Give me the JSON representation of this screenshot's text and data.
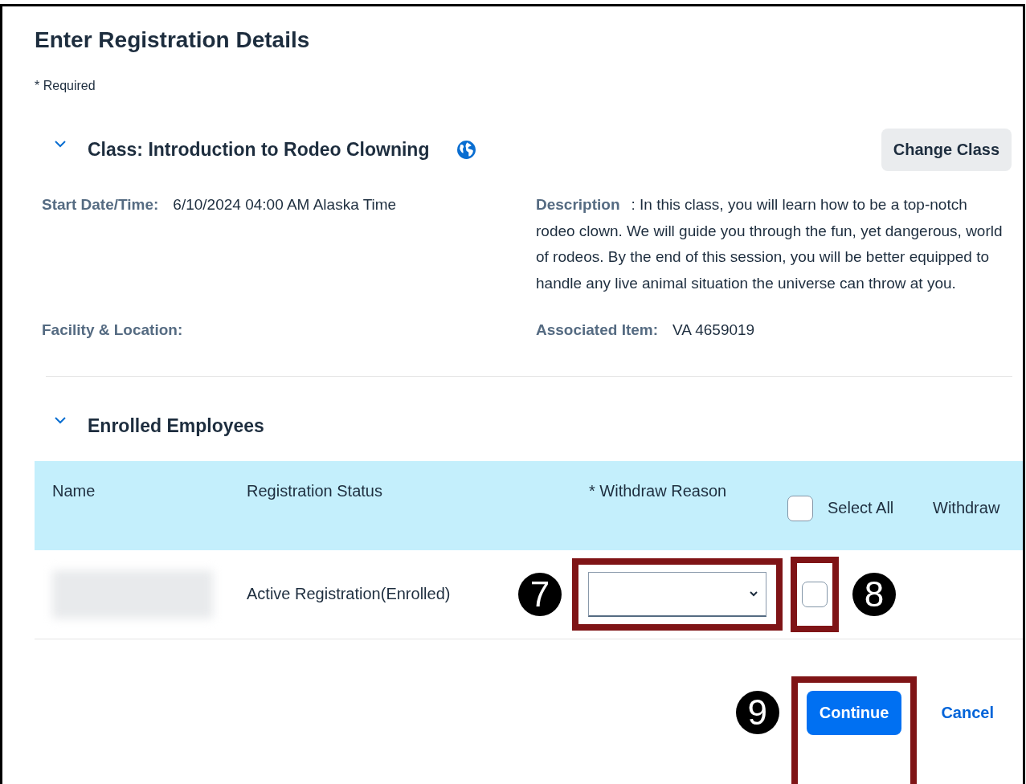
{
  "page": {
    "title": "Enter Registration Details",
    "required_note": "* Required"
  },
  "class_section": {
    "title": "Class: Introduction to Rodeo Clowning",
    "expanded": true,
    "change_button": "Change Class",
    "fields": [
      {
        "kind": "pair",
        "label": "Start Date/Time:",
        "value": "6/10/2024 04:00 AM Alaska Time"
      },
      {
        "kind": "paragraph",
        "label": "Description",
        "value": ": In this class, you will learn how to be a top-notch rodeo clown. We will guide you through the fun, yet dangerous, world of rodeos. By the end of this session, you will be better equipped to handle any live animal situation the universe can throw at you."
      },
      {
        "kind": "pair",
        "label": "Facility & Location:"
      },
      {
        "kind": "pair",
        "label": "Associated Item:",
        "value": "VA 4659019"
      }
    ]
  },
  "enrolled": {
    "title": "Enrolled Employees",
    "expanded": true,
    "columns": [
      "Name",
      "Registration Status",
      "* Withdraw Reason"
    ],
    "select_all": {
      "label": "Select All",
      "checked": false
    },
    "withdraw_column": "Withdraw",
    "rows": [
      {
        "status": "Active Registration(Enrolled)",
        "withdraw": false
      }
    ]
  },
  "annotations": {
    "reason": "7",
    "withdraw": "8",
    "continue": "9"
  },
  "actions": {
    "continue": "Continue",
    "cancel": "Cancel"
  }
}
